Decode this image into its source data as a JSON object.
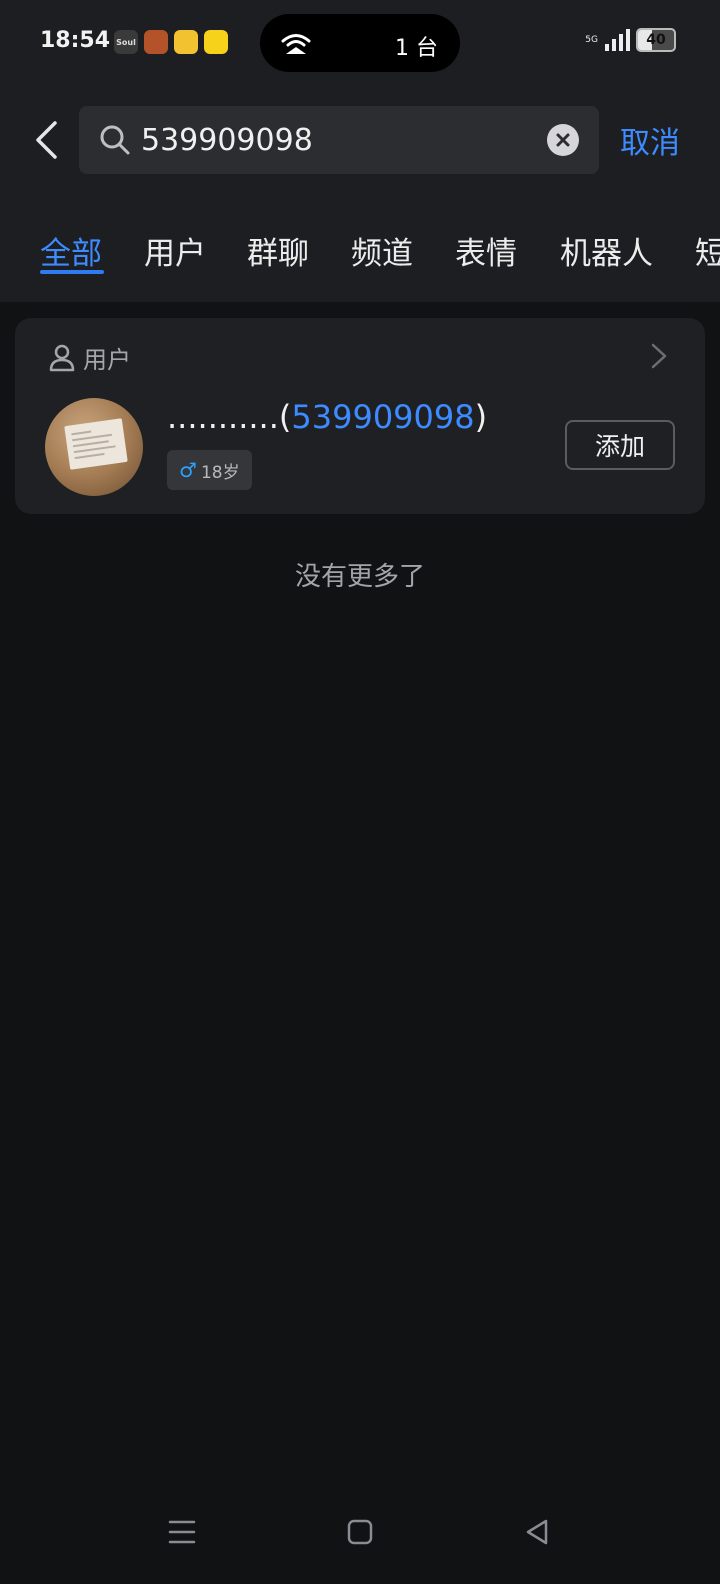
{
  "status_bar": {
    "time": "18:54",
    "apps": [
      "Soul",
      "game-app",
      "notes-app",
      "news-app"
    ],
    "island_count": "1 台",
    "network": "5G",
    "battery": "40"
  },
  "search": {
    "query": "539909098",
    "cancel_label": "取消"
  },
  "tabs": [
    {
      "label": "全部",
      "active": true
    },
    {
      "label": "用户",
      "active": false
    },
    {
      "label": "群聊",
      "active": false
    },
    {
      "label": "频道",
      "active": false
    },
    {
      "label": "表情",
      "active": false
    },
    {
      "label": "机器人",
      "active": false
    },
    {
      "label": "短",
      "active": false
    }
  ],
  "result": {
    "section_label": "用户",
    "name": "...........",
    "id": "539909098",
    "gender_symbol": "♂",
    "age": "18岁",
    "add_label": "添加"
  },
  "footer": {
    "no_more": "没有更多了"
  },
  "colors": {
    "accent": "#3d8bff",
    "background": "#111214",
    "surface": "#1f2023"
  }
}
